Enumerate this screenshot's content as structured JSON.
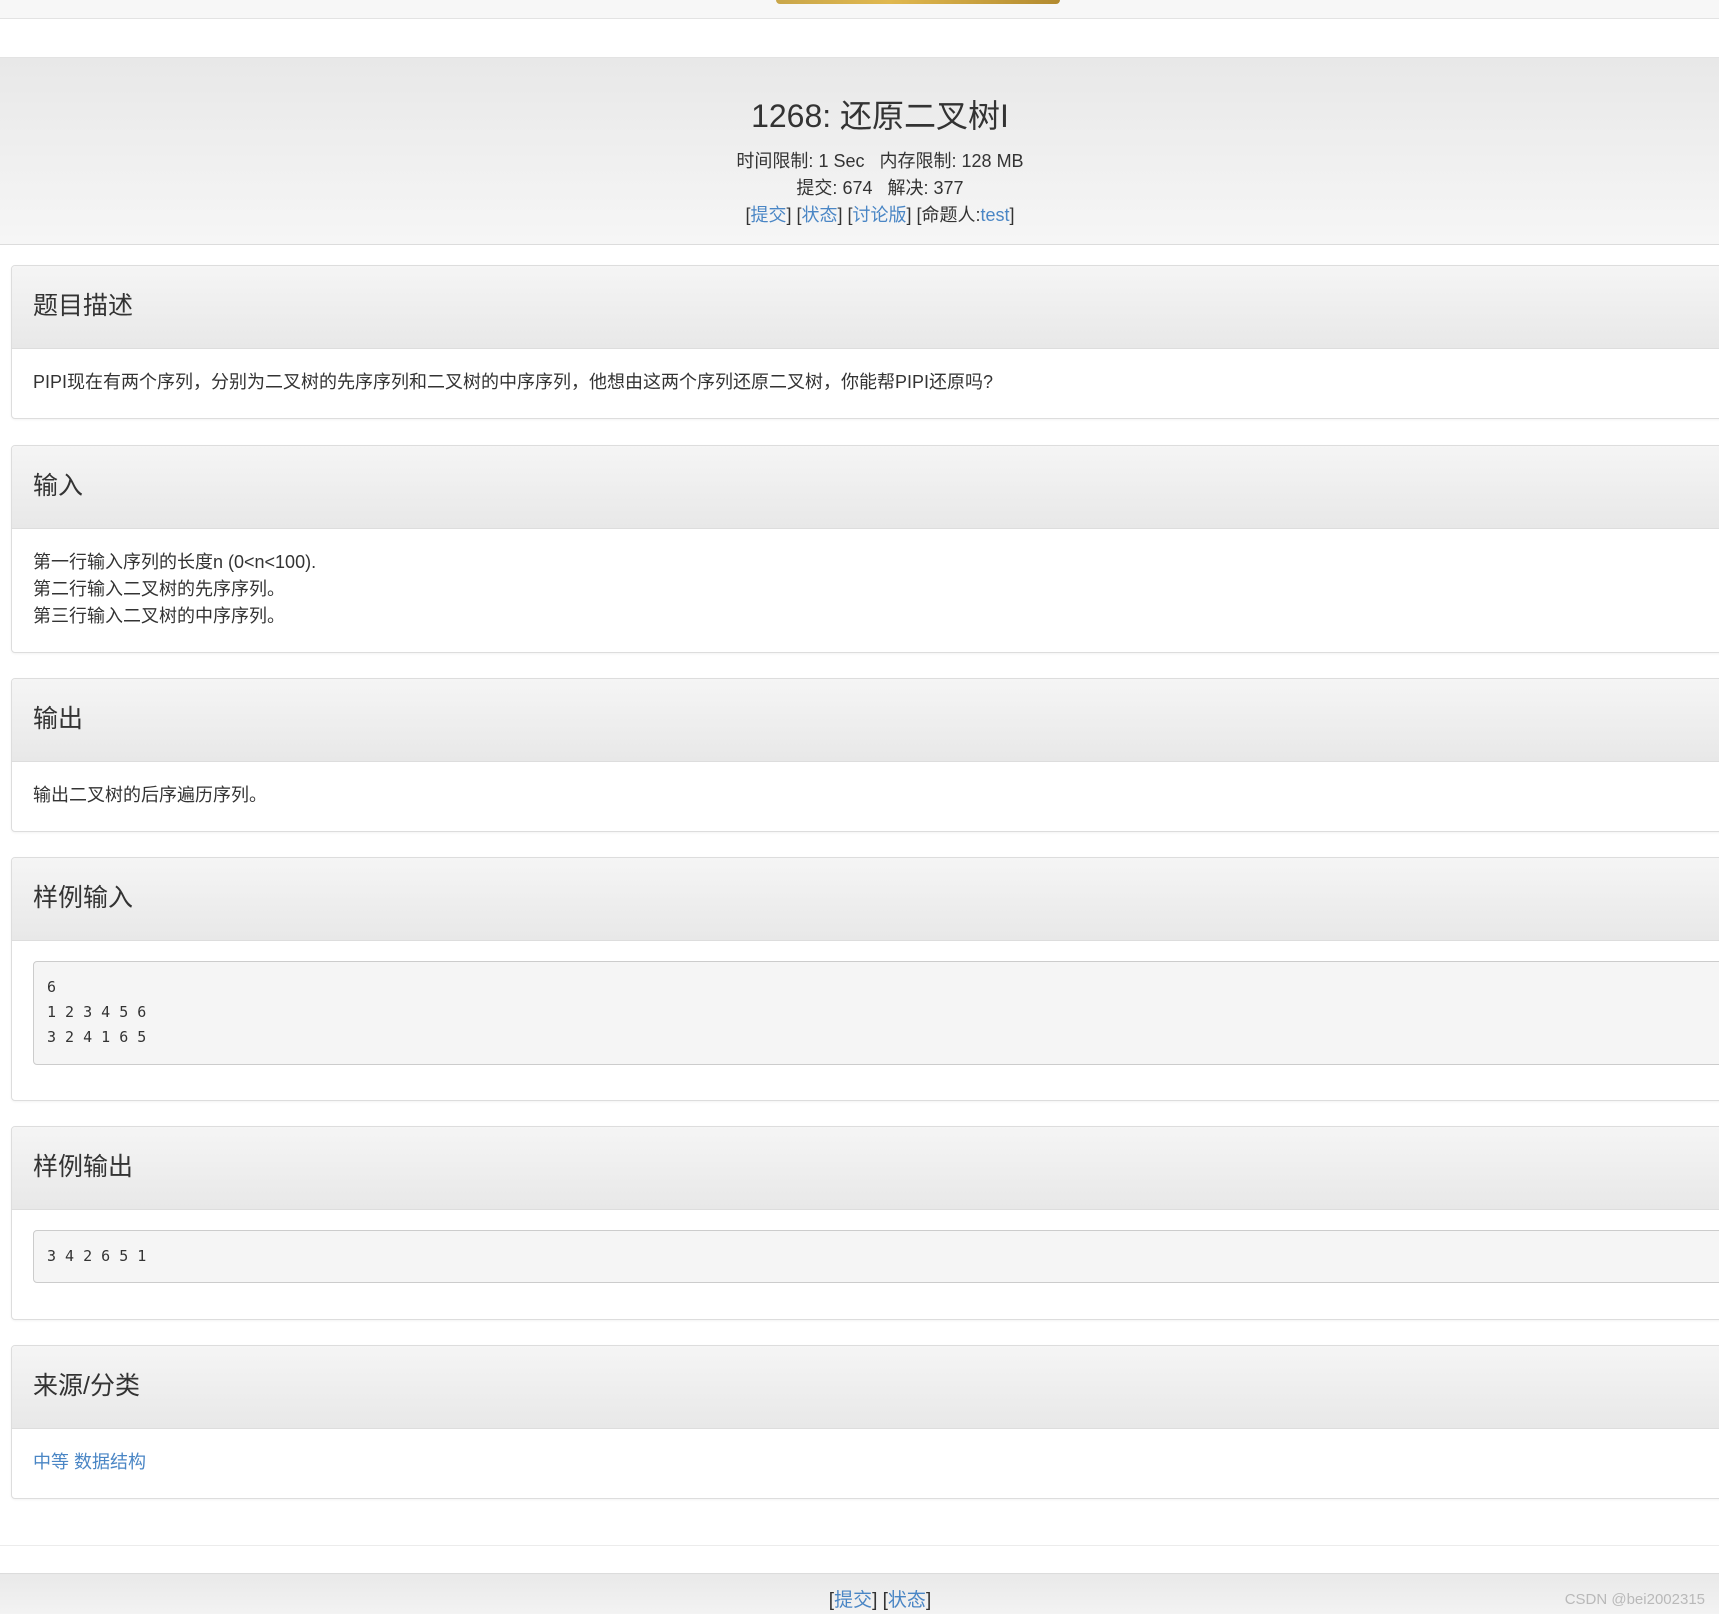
{
  "problem": {
    "title": "1268: 还原二叉树I",
    "time_limit_label": "时间限制:",
    "time_limit": "1 Sec",
    "memory_limit_label": "内存限制:",
    "memory_limit": "128 MB",
    "submit_count_label": "提交:",
    "submit_count": "674",
    "solved_count_label": "解决:",
    "solved_count": "377",
    "links": {
      "submit": "提交",
      "status": "状态",
      "discuss": "讨论版",
      "author_label": "命题人:",
      "author": "test"
    }
  },
  "sections": {
    "description": {
      "heading": "题目描述",
      "text": "PIPI现在有两个序列，分别为二叉树的先序序列和二叉树的中序序列，他想由这两个序列还原二叉树，你能帮PIPI还原吗?"
    },
    "input": {
      "heading": "输入",
      "lines": [
        "第一行输入序列的长度n (0<n<100).",
        "第二行输入二叉树的先序序列。",
        "第三行输入二叉树的中序序列。"
      ]
    },
    "output": {
      "heading": "输出",
      "text": "输出二叉树的后序遍历序列。"
    },
    "sample_input": {
      "heading": "样例输入",
      "code": "6\n1 2 3 4 5 6\n3 2 4 1 6 5"
    },
    "sample_output": {
      "heading": "样例输出",
      "code": "3 4 2 6 5 1"
    },
    "source": {
      "heading": "来源/分类",
      "tags": [
        "中等",
        "数据结构"
      ]
    }
  },
  "footer": {
    "submit": "提交",
    "status": "状态",
    "watermark": "CSDN @bei2002315"
  },
  "colors": {
    "link": "#4a86c5",
    "text": "#333333",
    "panel_heading_bg": "#f0f0f0",
    "code_bg": "#f5f5f5"
  }
}
